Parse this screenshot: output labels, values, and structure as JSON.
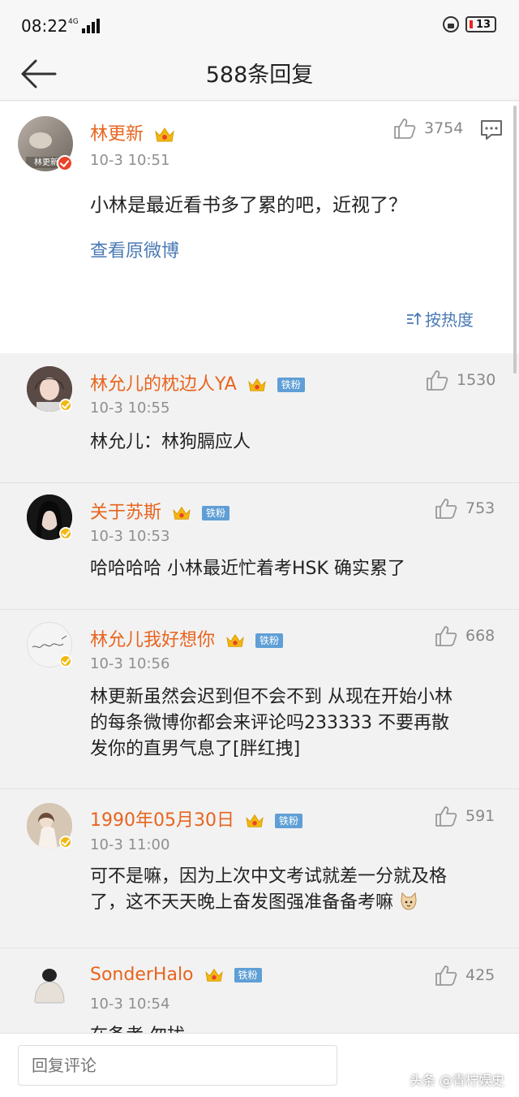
{
  "status_bar": {
    "time": "08:22",
    "network": "4G",
    "battery": "13"
  },
  "nav": {
    "title": "588条回复"
  },
  "main_comment": {
    "username": "林更新",
    "avatar_caption": "林更新",
    "time": "10-3 10:51",
    "likes": "3754",
    "text": "小林是最近看书多了累的吧，近视了？",
    "view_original": "查看原微博",
    "sort_label": "按热度"
  },
  "replies": [
    {
      "username": "林允儿的枕边人YA",
      "badge": "铁粉",
      "time": "10-3 10:55",
      "likes": "1530",
      "text": "林允儿：林狗膈应人"
    },
    {
      "username": "关于苏斯",
      "badge": "铁粉",
      "time": "10-3 10:53",
      "likes": "753",
      "text": "哈哈哈哈 小林最近忙着考HSK 确实累了"
    },
    {
      "username": "林允儿我好想你",
      "badge": "铁粉",
      "time": "10-3 10:56",
      "likes": "668",
      "text_lines": [
        "林更新虽然会迟到但不会不到 从现在开始小林",
        "的每条微博你都会来评论吗233333 不要再散",
        "发你的直男气息了[胖红拽]"
      ]
    },
    {
      "username": "1990年05月30日",
      "badge": "铁粉",
      "time": "10-3 11:00",
      "likes": "591",
      "text_lines": [
        "可不是嘛，因为上次中文考试就差一分就及格",
        "了，这不天天晚上奋发图强准备备考嘛"
      ]
    },
    {
      "username": "SonderHalo",
      "badge": "铁粉",
      "time": "10-3 10:54",
      "likes": "425",
      "text": "在备考 勿扰"
    }
  ],
  "bottom_bar": {
    "placeholder": "回复评论",
    "watermark": "头条 @青柠娱史"
  },
  "colors": {
    "username": "#e8641d",
    "link": "#4a7ab4",
    "badge": "#5f9fd6",
    "crown": "#f2b712",
    "verified_red": "#e8442a"
  }
}
